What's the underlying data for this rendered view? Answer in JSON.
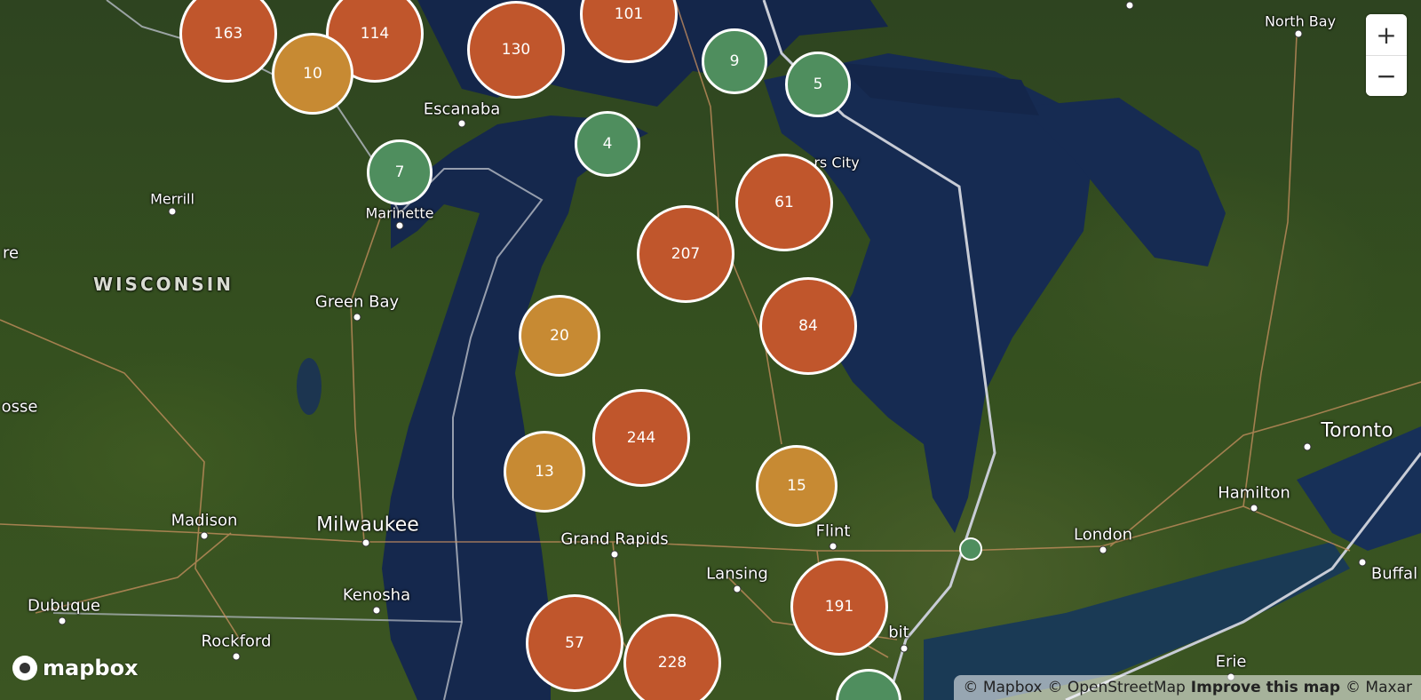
{
  "map": {
    "cities": [
      {
        "name": "North Bay"
      },
      {
        "name": "Escanaba"
      },
      {
        "name": "Merrill"
      },
      {
        "name": "Marinette"
      },
      {
        "name": "Green Bay"
      },
      {
        "name": "Madison"
      },
      {
        "name": "Milwaukee"
      },
      {
        "name": "Kenosha"
      },
      {
        "name": "Dubuque"
      },
      {
        "name": "Rockford"
      },
      {
        "name": "Grand Rapids"
      },
      {
        "name": "Lansing"
      },
      {
        "name": "Flint"
      },
      {
        "name": "London"
      },
      {
        "name": "Hamilton"
      },
      {
        "name": "Toronto"
      },
      {
        "name": "Buffal"
      },
      {
        "name": "Erie"
      },
      {
        "name": "rs City"
      },
      {
        "name": "bit"
      },
      {
        "name": "re"
      },
      {
        "name": "osse"
      }
    ],
    "regions": [
      {
        "name": "WISCONSIN"
      }
    ],
    "clusters": [
      {
        "count": "163",
        "size": "large"
      },
      {
        "count": "114",
        "size": "large"
      },
      {
        "count": "10",
        "size": "medium"
      },
      {
        "count": "130",
        "size": "large"
      },
      {
        "count": "101",
        "size": "large"
      },
      {
        "count": "9",
        "size": "small"
      },
      {
        "count": "5",
        "size": "small"
      },
      {
        "count": "4",
        "size": "small"
      },
      {
        "count": "7",
        "size": "small"
      },
      {
        "count": "61",
        "size": "large"
      },
      {
        "count": "207",
        "size": "large"
      },
      {
        "count": "84",
        "size": "large"
      },
      {
        "count": "20",
        "size": "medium"
      },
      {
        "count": "244",
        "size": "large"
      },
      {
        "count": "13",
        "size": "medium"
      },
      {
        "count": "15",
        "size": "medium"
      },
      {
        "count": "191",
        "size": "large"
      },
      {
        "count": "57",
        "size": "large"
      },
      {
        "count": "228",
        "size": "large"
      },
      {
        "count": "",
        "size": "small"
      },
      {
        "count": "",
        "size": "point"
      }
    ],
    "colors": {
      "cluster_large": "#c0562c",
      "cluster_medium": "#c78a33",
      "cluster_small": "#4f8e5e",
      "water": "#14264a",
      "land": "#35501f"
    }
  },
  "controls": {
    "zoom_in": "+",
    "zoom_out": "−"
  },
  "branding": {
    "logo_text": "mapbox"
  },
  "attribution": {
    "mapbox": "© Mapbox",
    "osm": "© OpenStreetMap",
    "improve": "Improve this map",
    "maxar": "© Maxar"
  }
}
